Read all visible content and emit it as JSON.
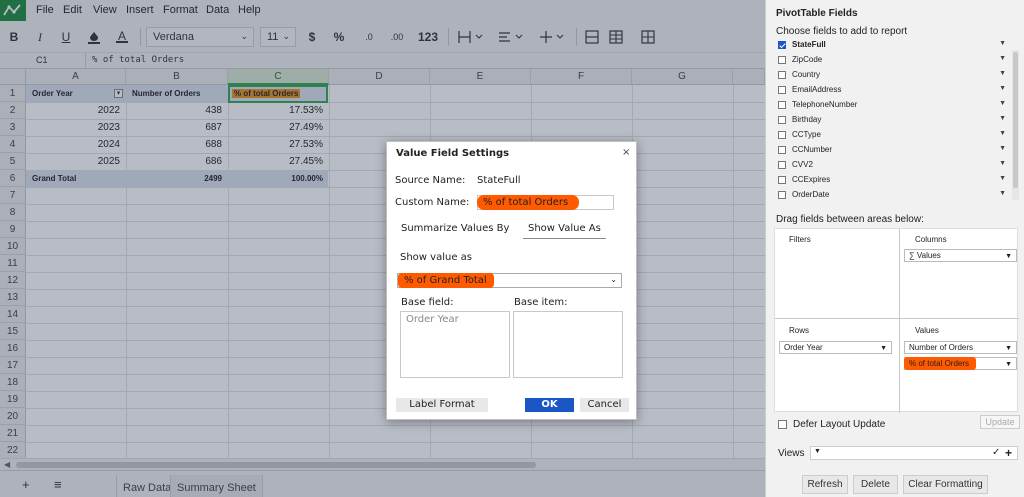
{
  "menu": {
    "items": [
      "File",
      "Edit",
      "View",
      "Insert",
      "Format",
      "Data",
      "Help"
    ]
  },
  "toolbar": {
    "bold": "B",
    "italic": "I",
    "underline": "U",
    "font_color_letter": "A",
    "font_name": "Verdana",
    "font_size": "11",
    "currency": "$",
    "percent": "%",
    "dec_decrease": ".0",
    "dec_increase": ".00",
    "number_format": "123"
  },
  "formula_bar": {
    "cell_ref": "C1",
    "content": "% of total Orders"
  },
  "grid": {
    "columns": [
      "A",
      "B",
      "C",
      "D",
      "E",
      "F",
      "G"
    ],
    "rows": [
      "1",
      "2",
      "3",
      "4",
      "5",
      "6",
      "7",
      "8",
      "9",
      "10",
      "11",
      "12",
      "13",
      "14",
      "15",
      "16",
      "17",
      "18",
      "19",
      "20",
      "21",
      "22"
    ],
    "pivot": {
      "headers": [
        "Order Year",
        "Number of Orders",
        "% of total Orders"
      ],
      "rows": [
        {
          "year": "2022",
          "orders": "438",
          "pct": "17.53%"
        },
        {
          "year": "2023",
          "orders": "687",
          "pct": "27.49%"
        },
        {
          "year": "2024",
          "orders": "688",
          "pct": "27.53%"
        },
        {
          "year": "2025",
          "orders": "686",
          "pct": "27.45%"
        }
      ],
      "total": {
        "label": "Grand Total",
        "orders": "2499",
        "pct": "100.00%"
      }
    }
  },
  "sheet_tabs": {
    "add": "+",
    "list": "≡",
    "tabs": [
      "Raw Data",
      "Summary Sheet"
    ],
    "active": "Summary Sheet"
  },
  "dialog": {
    "title": "Value Field Settings",
    "close": "×",
    "source_label": "Source Name:",
    "source_value": "StateFull",
    "custom_label": "Custom Name:",
    "custom_value": "% of total Orders",
    "tabs": [
      "Summarize Values By",
      "Show Value As"
    ],
    "active_tab": "Show Value As",
    "show_value_label": "Show value as",
    "show_value_selected": "% of Grand Total",
    "base_field_label": "Base field:",
    "base_item_label": "Base item:",
    "base_field_items": [
      "Order Year"
    ],
    "buttons": {
      "label_format": "Label Format",
      "ok": "OK",
      "cancel": "Cancel"
    }
  },
  "pivot_panel": {
    "title": "PivotTable Fields",
    "choose_label": "Choose fields to add to report",
    "fields": [
      {
        "name": "StateFull",
        "checked": true
      },
      {
        "name": "ZipCode",
        "checked": false
      },
      {
        "name": "Country",
        "checked": false
      },
      {
        "name": "EmailAddress",
        "checked": false
      },
      {
        "name": "TelephoneNumber",
        "checked": false
      },
      {
        "name": "Birthday",
        "checked": false
      },
      {
        "name": "CCType",
        "checked": false
      },
      {
        "name": "CCNumber",
        "checked": false
      },
      {
        "name": "CVV2",
        "checked": false
      },
      {
        "name": "CCExpires",
        "checked": false
      },
      {
        "name": "OrderDate",
        "checked": false
      }
    ],
    "drag_label": "Drag fields between areas below:",
    "areas": {
      "filters": {
        "label": "Filters",
        "items": []
      },
      "columns": {
        "label": "Columns",
        "items": [
          "∑ Values"
        ]
      },
      "rows": {
        "label": "Rows",
        "items": [
          "Order Year"
        ]
      },
      "values": {
        "label": "Values",
        "items": [
          "Number of Orders",
          "% of total Orders"
        ]
      }
    },
    "defer_label": "Defer Layout Update",
    "update_label": "Update",
    "views_label": "Views",
    "buttons": {
      "refresh": "Refresh",
      "delete": "Delete",
      "clear": "Clear Formatting"
    }
  },
  "colors": {
    "highlight_orange": "#ff5a00",
    "ok_blue": "#1a56c5",
    "selection_green": "#34a853",
    "pivot_header_bg": "#dce3ee"
  }
}
